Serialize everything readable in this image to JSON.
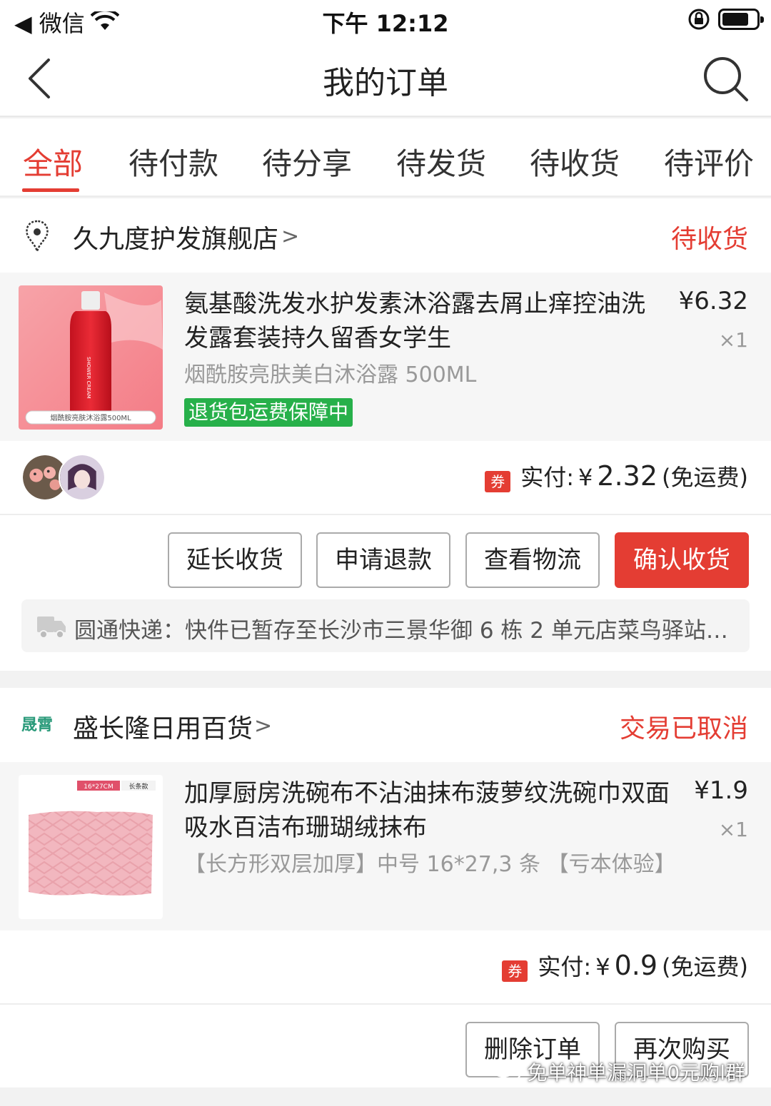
{
  "status_bar": {
    "carrier": "◀ 微信",
    "time": "下午 12:12"
  },
  "nav": {
    "title": "我的订单"
  },
  "tabs": [
    "全部",
    "待付款",
    "待分享",
    "待发货",
    "待收货",
    "待评价"
  ],
  "orders": [
    {
      "shop_name": "久九度护发旗舰店",
      "status": "待收货",
      "item": {
        "title": "氨基酸洗发水护发素沐浴露去屑止痒控油洗发露套装持久留香女学生",
        "price": "¥6.32",
        "qty": "×1",
        "sku": "烟酰胺亮肤美白沐浴露 500ML",
        "badge": "退货包运费保障中",
        "thumb_caption": "烟酰胺亮肤沐浴露500ML",
        "thumb_bottle_text": "SHOWER CREAM"
      },
      "payment": {
        "label": "实付:",
        "currency": "¥",
        "amount": "2.32",
        "note": "(免运费)",
        "coupon": "券"
      },
      "buttons": [
        "延长收货",
        "申请退款",
        "查看物流",
        "确认收货"
      ],
      "logistics": "圆通快递：快件已暂存至长沙市三景华御 6 栋 2 单元店菜鸟驿站…"
    },
    {
      "shop_name": "盛长隆日用百货",
      "shop_logo_text": "晟霄",
      "status": "交易已取消",
      "item": {
        "title": "加厚厨房洗碗布不沾油抹布菠萝纹洗碗巾双面吸水百洁布珊瑚绒抹布",
        "price": "¥1.9",
        "qty": "×1",
        "sku": "【长方形双层加厚】中号 16*27,3 条 【亏本体验】",
        "thumb_tag_size": "16*27CM",
        "thumb_tag_type": "长条款"
      },
      "payment": {
        "label": "实付:",
        "currency": "¥",
        "amount": "0.9",
        "note": "(免运费)",
        "coupon": "券"
      },
      "buttons": [
        "删除订单",
        "再次购买"
      ]
    }
  ],
  "watermark": "免单神单漏洞单0元购l群",
  "colors": {
    "accent": "#e43d33",
    "badge_green": "#27b04a"
  }
}
